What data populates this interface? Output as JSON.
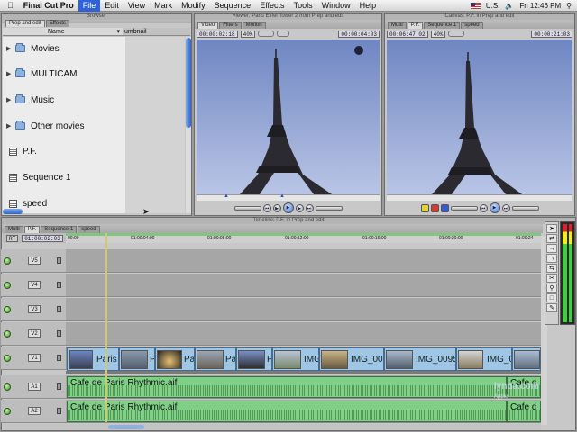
{
  "menubar": {
    "app": "Final Cut Pro",
    "items": [
      "File",
      "Edit",
      "View",
      "Mark",
      "Modify",
      "Sequence",
      "Effects",
      "Tools",
      "Window",
      "Help"
    ],
    "selected": "File",
    "keyboard": "U.S.",
    "clock": "Fri 12:46 PM"
  },
  "browser": {
    "title": "Browser",
    "tabs": [
      "Prep and edit",
      "Effects"
    ],
    "col_name": "Name",
    "col_thumb": "umbnail",
    "items": [
      {
        "label": "Movies",
        "kind": "folder"
      },
      {
        "label": "MULTICAM",
        "kind": "folder"
      },
      {
        "label": "Music",
        "kind": "folder"
      },
      {
        "label": "Other movies",
        "kind": "folder"
      },
      {
        "label": "P.F.",
        "kind": "sequence"
      },
      {
        "label": "Sequence 1",
        "kind": "sequence"
      },
      {
        "label": "speed",
        "kind": "sequence"
      }
    ]
  },
  "viewer": {
    "title": "Viewer: Paris Eiffel Tower 2 from Prep and edit",
    "tabs": [
      "Video",
      "Filters",
      "Motion"
    ],
    "timecode_left": "00:00:02:18",
    "zoom": "40%",
    "timecode_right": "00:00:04:03"
  },
  "canvas": {
    "title": "Canvas: P.F. in Prep and edit",
    "tabs": [
      "Multi",
      "P.F.",
      "Sequence 1",
      "speed"
    ],
    "timecode_left": "00:06:47:02",
    "zoom": "40%",
    "timecode_right": "00:00:21:03"
  },
  "timeline": {
    "title": "Timeline: P.F. in Prep and edit",
    "tabs": [
      "Multi",
      "P.F.",
      "Sequence 1",
      "speed"
    ],
    "rt": "RT",
    "playhead": "01:00:02:03",
    "ruler": [
      "00:00",
      "01:00:04:00",
      "01:00:08:00",
      "01:00:12:00",
      "01:00:16:00",
      "01:00:20:00",
      "01:00:24"
    ],
    "video_tracks": [
      "V5",
      "V4",
      "V3",
      "V2",
      "V1"
    ],
    "audio_tracks": [
      "A1",
      "A2"
    ],
    "clips": [
      {
        "label": "Paris"
      },
      {
        "label": "P"
      },
      {
        "label": "Pa"
      },
      {
        "label": "Pai"
      },
      {
        "label": "P"
      },
      {
        "label": "IMG"
      },
      {
        "label": "IMG_00"
      },
      {
        "label": "IMG_0095"
      },
      {
        "label": "IMG_0"
      }
    ],
    "audio_clip": "Cafe de Paris Rhythmic.aif",
    "audio_clip_short": "Cafe d"
  },
  "watermark": {
    "brand": "lynda.com",
    "sub": "Apple"
  },
  "colors": {
    "selection": "#2f62d6",
    "clip_video": "#9fc6e4",
    "clip_audio": "#7fcf86",
    "track_enabled": "#3a8a1e"
  }
}
